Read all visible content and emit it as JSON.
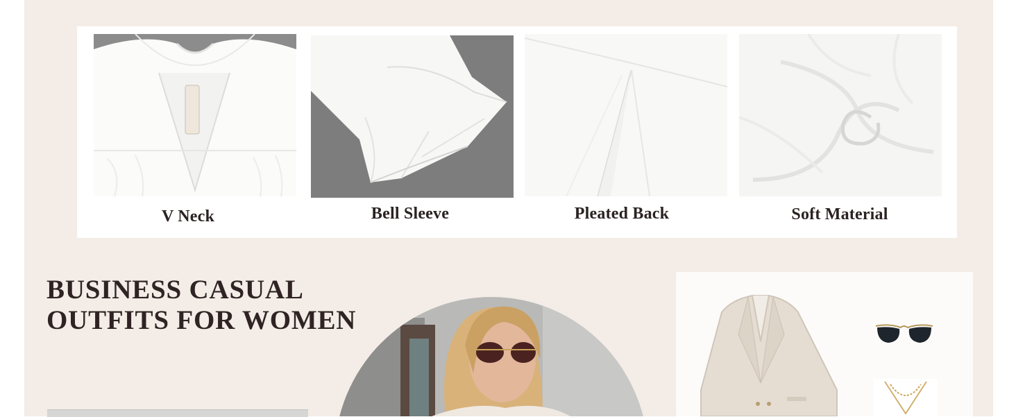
{
  "features": [
    {
      "label": "V Neck",
      "image": "v-neck-collar-detail-photo"
    },
    {
      "label": "Bell Sleeve",
      "image": "bell-sleeve-detail-photo"
    },
    {
      "label": "Pleated Back",
      "image": "pleated-back-detail-photo"
    },
    {
      "label": "Soft Material",
      "image": "soft-material-swirl-photo"
    }
  ],
  "headline": {
    "line1": "BUSINESS CASUAL",
    "line2": "OUTFITS FOR WOMEN"
  },
  "colors": {
    "panel_bg": "#f3ece7",
    "card_bg": "#ffffff",
    "text": "#2f2423",
    "photo_gray": "#808080"
  }
}
